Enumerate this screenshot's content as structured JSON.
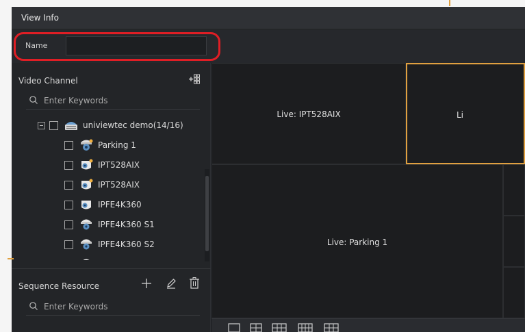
{
  "window": {
    "title": "View Info"
  },
  "name_field": {
    "label": "Name",
    "value": "",
    "placeholder": ""
  },
  "video_channel": {
    "title": "Video Channel",
    "search_placeholder": "Enter Keywords",
    "root": {
      "label": "univiewtec demo(14/16)",
      "checked": false,
      "expanded": true
    },
    "items": [
      {
        "label": "Parking 1",
        "icon": "fisheye-camera-icon"
      },
      {
        "label": "IPT528AIX",
        "icon": "ptz-camera-icon"
      },
      {
        "label": "IPT528AIX",
        "icon": "ptz-camera-icon"
      },
      {
        "label": "IPFE4K360",
        "icon": "ptz-camera-icon"
      },
      {
        "label": "IPFE4K360 S1",
        "icon": "dome-camera-icon"
      },
      {
        "label": "IPFE4K360 S2",
        "icon": "dome-camera-icon"
      }
    ]
  },
  "sequence_resource": {
    "title": "Sequence Resource",
    "search_placeholder": "Enter Keywords"
  },
  "video_grid": {
    "cells": [
      {
        "label": "Live: IPT528AIX",
        "active": false
      },
      {
        "label": "Li",
        "active": true
      },
      {
        "label": "Live: Parking 1",
        "active": false
      }
    ]
  },
  "colors": {
    "highlight": "#e01e25",
    "active_cell": "#e0a040",
    "background": "#1b1d20"
  }
}
